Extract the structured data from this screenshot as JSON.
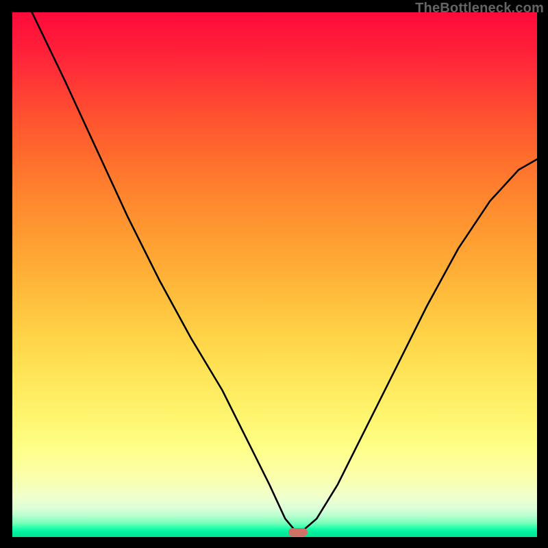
{
  "attribution": "TheBottleneck.com",
  "colors": {
    "frame": "#000000",
    "marker": "#cf7164",
    "curve": "#000000"
  },
  "marker": {
    "x_frac": 0.545,
    "y_frac": 0.995
  },
  "chart_data": {
    "type": "line",
    "title": "",
    "xlabel": "",
    "ylabel": "",
    "xlim": [
      0,
      1
    ],
    "ylim": [
      0,
      1
    ],
    "grid": false,
    "series": [
      {
        "name": "left-branch",
        "x": [
          0.0375,
          0.1,
          0.16,
          0.22,
          0.28,
          0.34,
          0.4,
          0.45,
          0.49,
          0.52,
          0.545
        ],
        "y": [
          1.0,
          0.87,
          0.74,
          0.61,
          0.49,
          0.38,
          0.28,
          0.18,
          0.1,
          0.035,
          0.005
        ]
      },
      {
        "name": "right-branch",
        "x": [
          0.545,
          0.58,
          0.62,
          0.67,
          0.73,
          0.79,
          0.85,
          0.91,
          0.965,
          1.0
        ],
        "y": [
          0.005,
          0.035,
          0.1,
          0.2,
          0.32,
          0.44,
          0.55,
          0.64,
          0.7,
          0.72
        ]
      }
    ],
    "background_gradient": {
      "top": "#ff0a3a",
      "mid_upper": "#ff9430",
      "mid": "#ffed63",
      "mid_lower": "#feff88",
      "bottom": "#00e294"
    },
    "annotations": [
      {
        "type": "marker",
        "shape": "pill",
        "x": 0.545,
        "y": 0.005,
        "color": "#cf7164"
      }
    ]
  }
}
